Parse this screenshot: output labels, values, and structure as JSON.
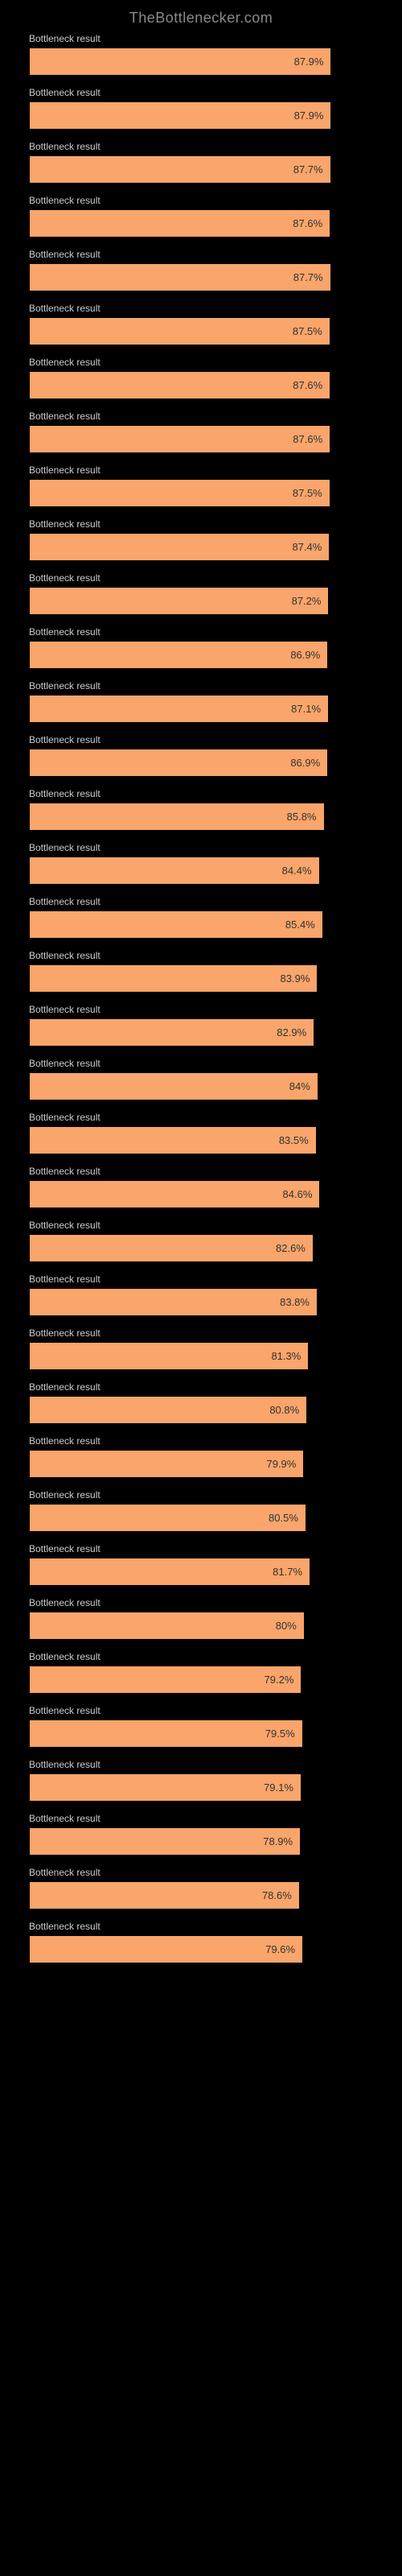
{
  "header": {
    "title": "TheBottlenecker.com"
  },
  "chart_data": {
    "type": "bar",
    "title": "TheBottlenecker.com",
    "xlabel": "",
    "ylabel": "",
    "xlim": [
      0,
      100
    ],
    "max_value": 100,
    "series": [
      {
        "label": "Bottleneck result",
        "value": 87.9
      },
      {
        "label": "Bottleneck result",
        "value": 87.9
      },
      {
        "label": "Bottleneck result",
        "value": 87.7
      },
      {
        "label": "Bottleneck result",
        "value": 87.6
      },
      {
        "label": "Bottleneck result",
        "value": 87.7
      },
      {
        "label": "Bottleneck result",
        "value": 87.5
      },
      {
        "label": "Bottleneck result",
        "value": 87.6
      },
      {
        "label": "Bottleneck result",
        "value": 87.6
      },
      {
        "label": "Bottleneck result",
        "value": 87.5
      },
      {
        "label": "Bottleneck result",
        "value": 87.4
      },
      {
        "label": "Bottleneck result",
        "value": 87.2
      },
      {
        "label": "Bottleneck result",
        "value": 86.9
      },
      {
        "label": "Bottleneck result",
        "value": 87.1
      },
      {
        "label": "Bottleneck result",
        "value": 86.9
      },
      {
        "label": "Bottleneck result",
        "value": 85.8
      },
      {
        "label": "Bottleneck result",
        "value": 84.4
      },
      {
        "label": "Bottleneck result",
        "value": 85.4
      },
      {
        "label": "Bottleneck result",
        "value": 83.9
      },
      {
        "label": "Bottleneck result",
        "value": 82.9
      },
      {
        "label": "Bottleneck result",
        "value": 84.0
      },
      {
        "label": "Bottleneck result",
        "value": 83.5
      },
      {
        "label": "Bottleneck result",
        "value": 84.6
      },
      {
        "label": "Bottleneck result",
        "value": 82.6
      },
      {
        "label": "Bottleneck result",
        "value": 83.8
      },
      {
        "label": "Bottleneck result",
        "value": 81.3
      },
      {
        "label": "Bottleneck result",
        "value": 80.8
      },
      {
        "label": "Bottleneck result",
        "value": 79.9
      },
      {
        "label": "Bottleneck result",
        "value": 80.5
      },
      {
        "label": "Bottleneck result",
        "value": 81.7
      },
      {
        "label": "Bottleneck result",
        "value": 80.0
      },
      {
        "label": "Bottleneck result",
        "value": 79.2
      },
      {
        "label": "Bottleneck result",
        "value": 79.5
      },
      {
        "label": "Bottleneck result",
        "value": 79.1
      },
      {
        "label": "Bottleneck result",
        "value": 78.9
      },
      {
        "label": "Bottleneck result",
        "value": 78.6
      },
      {
        "label": "Bottleneck result",
        "value": 79.6
      }
    ]
  },
  "colors": {
    "bar_fill": "#f9a56b",
    "background": "#000000",
    "label_text": "#cccccc",
    "value_text": "#333333",
    "header_text": "#8a8a8a"
  }
}
